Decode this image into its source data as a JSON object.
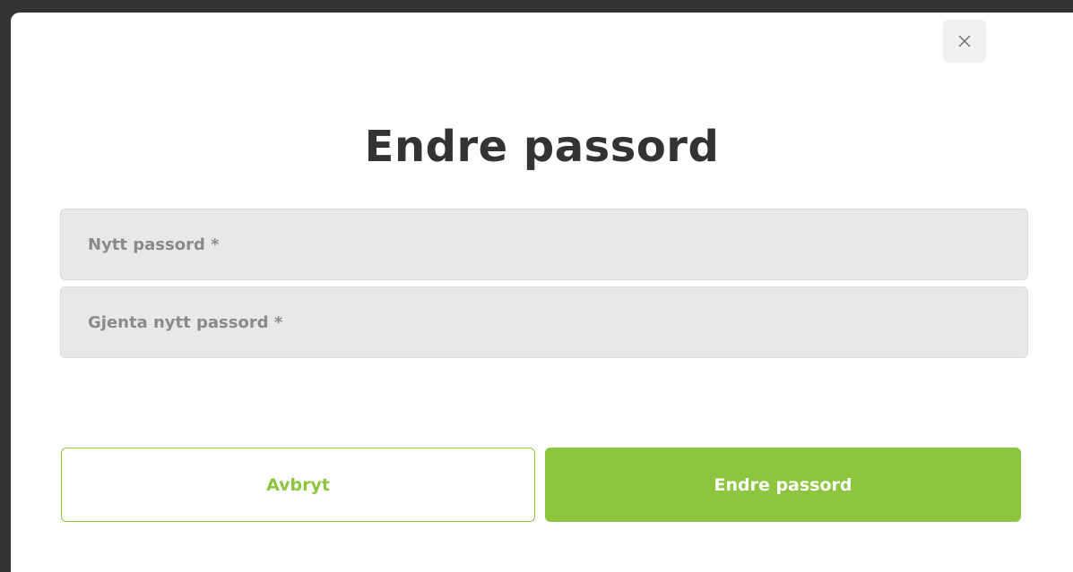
{
  "dialog": {
    "title": "Endre passord",
    "close_icon": "close-icon"
  },
  "form": {
    "new_password": {
      "placeholder": "Nytt passord *",
      "value": ""
    },
    "repeat_password": {
      "placeholder": "Gjenta nytt passord *",
      "value": ""
    }
  },
  "actions": {
    "cancel_label": "Avbryt",
    "submit_label": "Endre passord"
  },
  "colors": {
    "accent": "#8cc63f",
    "title_text": "#333333",
    "field_background": "#e8e8e8",
    "placeholder_text": "#8a8a8a"
  }
}
